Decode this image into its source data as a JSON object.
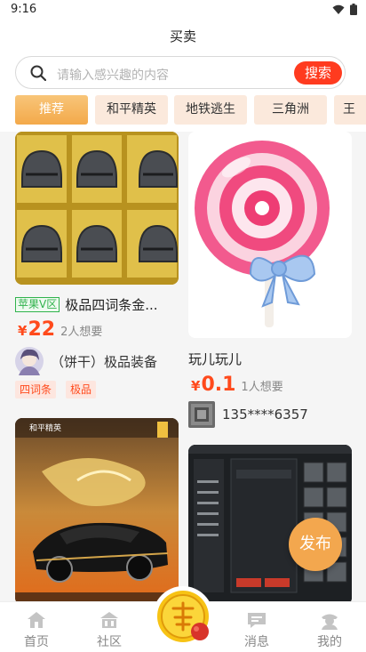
{
  "status": {
    "time": "9:16"
  },
  "header": {
    "title": "买卖"
  },
  "search": {
    "placeholder": "请输入感兴趣的内容",
    "button": "搜索"
  },
  "tabs": [
    {
      "label": "推荐",
      "active": true
    },
    {
      "label": "和平精英"
    },
    {
      "label": "地铁逃生"
    },
    {
      "label": "三角洲"
    },
    {
      "label": "王"
    }
  ],
  "items": [
    {
      "badge": "苹果V区",
      "title": "极品四词条金...",
      "price_symbol": "¥",
      "price": "22",
      "wants": "2人想要",
      "seller": "（饼干）极品装备",
      "tags": [
        "四词条",
        "极品"
      ]
    },
    {
      "title": "玩儿玩儿",
      "price_symbol": "¥",
      "price": "0.1",
      "wants": "1人想要",
      "seller": "135****6357"
    },
    {
      "image_label": "和平精英"
    },
    {
      "image_label": "发布"
    }
  ],
  "publish": {
    "label": "发布"
  },
  "nav": {
    "home": "首页",
    "community": "社区",
    "messages": "消息",
    "mine": "我的"
  },
  "colors": {
    "accent": "#ff4a1c",
    "tab_active": "#f3a94a",
    "publish": "#f3a74e"
  }
}
